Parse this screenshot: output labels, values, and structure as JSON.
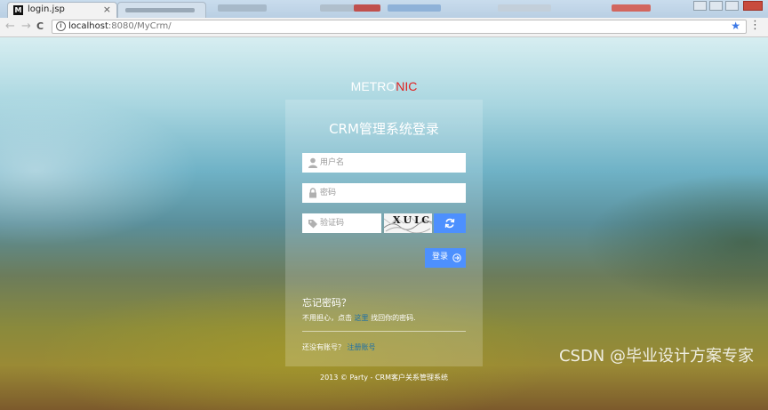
{
  "browser": {
    "tab_title": "login.jsp",
    "tab_favicon": "M",
    "tab_close": "×",
    "url_host": "localhost",
    "url_path": ":8080/MyCrm/",
    "nav_back": "←",
    "nav_forward": "→",
    "nav_reload": "C",
    "star": "★",
    "menu": "⋮"
  },
  "logo": {
    "prefix": "METRO",
    "accent": "NIC"
  },
  "login": {
    "title": "CRM管理系统登录",
    "username_placeholder": "用户名",
    "password_placeholder": "密码",
    "captcha_placeholder": "验证码",
    "captcha_text": "XUIC",
    "submit_label": "登录"
  },
  "forgot": {
    "title": "忘记密码？",
    "text_before": "不用担心，点击 ",
    "link": "这里",
    "text_after": " 找回你的密码."
  },
  "signup": {
    "text": "还没有账号？ ",
    "link": "注册账号"
  },
  "footer": "2013 © Party - CRM客户关系管理系统",
  "watermark": "CSDN @毕业设计方案专家",
  "colors": {
    "accent": "#4d90fe",
    "logo_accent": "#e02222",
    "link": "#1b6fa8"
  },
  "icons": [
    "info-icon",
    "star-icon",
    "menu-icon",
    "user-icon",
    "lock-icon",
    "tag-icon",
    "refresh-icon",
    "arrow-right-circle-icon"
  ]
}
